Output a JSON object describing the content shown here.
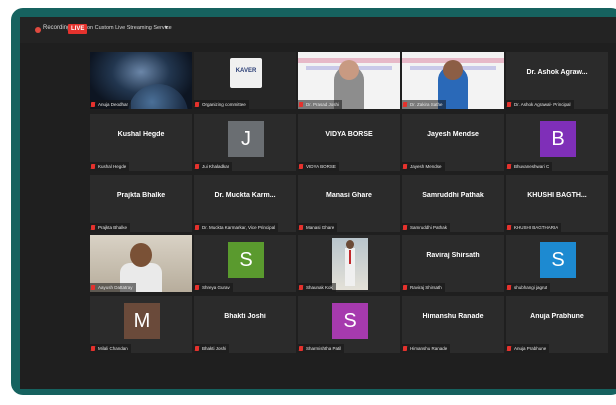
{
  "topbar": {
    "recording_label": "Recording",
    "live_label": "LIVE",
    "stream_label": "on Custom Live Streaming Service"
  },
  "colors": {
    "frame": "#16625f",
    "background": "#1f1f1f",
    "tile": "#2b2b2b",
    "live_red": "#e5322d",
    "speaker_highlight": "#c8d93a"
  },
  "rows": [
    [
      {
        "label": "Anuja Deodhar",
        "kind": "video",
        "video": "space-icon"
      },
      {
        "label": "Organizing committee",
        "kind": "video",
        "video": "logo-icon",
        "logo_text": "KAVER"
      },
      {
        "label": "Dr. Prasad Joshi",
        "kind": "video",
        "video": "person-icon",
        "speaking": true
      },
      {
        "label": "Dr. Zakira Sathe",
        "kind": "video",
        "video": "person-icon"
      },
      {
        "label": "Dr. Ashok Agrawal- Principal",
        "kind": "name",
        "display": "Dr. Ashok Agraw..."
      }
    ],
    [
      {
        "label": "Kushal Hegde",
        "kind": "name",
        "display": "Kushal Hegde"
      },
      {
        "label": "Jui Khaladkar",
        "kind": "avatar",
        "initial": "J",
        "color": "#6a6e72"
      },
      {
        "label": "VIDYA BORSE",
        "kind": "name",
        "display": "VIDYA BORSE"
      },
      {
        "label": "Jayesh Mendse",
        "kind": "name",
        "display": "Jayesh Mendse"
      },
      {
        "label": "Bhuvaneshwari C",
        "kind": "avatar",
        "initial": "B",
        "color": "#7f2fb8"
      }
    ],
    [
      {
        "label": "Prajkta Bhalke",
        "kind": "name",
        "display": "Prajkta Bhalke"
      },
      {
        "label": "Dr. Muckta Karmarkar, Vice Principal",
        "kind": "name",
        "display": "Dr. Muckta Karm..."
      },
      {
        "label": "Manasi Ghare",
        "kind": "name",
        "display": "Manasi Ghare"
      },
      {
        "label": "Samruddhi Pathak",
        "kind": "name",
        "display": "Samruddhi Pathak"
      },
      {
        "label": "KHUSHI BAGTHARIA",
        "kind": "name",
        "display": "KHUSHI BAGTH..."
      }
    ],
    [
      {
        "label": "Aayush Dattatray",
        "kind": "video",
        "video": "boy-icon"
      },
      {
        "label": "Shreya Gurav",
        "kind": "avatar",
        "initial": "S",
        "color": "#5a9a2e"
      },
      {
        "label": "Shaunak Kok",
        "kind": "video",
        "video": "standing-person-icon"
      },
      {
        "label": "Raviraj Shirsath",
        "kind": "name",
        "display": "Raviraj Shirsath"
      },
      {
        "label": "shubhangi jagrut",
        "kind": "avatar",
        "initial": "S",
        "color": "#1d8ad1"
      }
    ],
    [
      {
        "label": "Milali Chandan",
        "kind": "avatar",
        "initial": "M",
        "color": "#6a4a3a"
      },
      {
        "label": "Bhakti Joshi",
        "kind": "name",
        "display": "Bhakti Joshi"
      },
      {
        "label": "Sharmishtha Patil",
        "kind": "avatar",
        "initial": "S",
        "color": "#a63aae"
      },
      {
        "label": "Himanshu Ranade",
        "kind": "name",
        "display": "Himanshu Ranade"
      },
      {
        "label": "Anuja Prabhune",
        "kind": "name",
        "display": "Anuja Prabhune"
      }
    ]
  ]
}
